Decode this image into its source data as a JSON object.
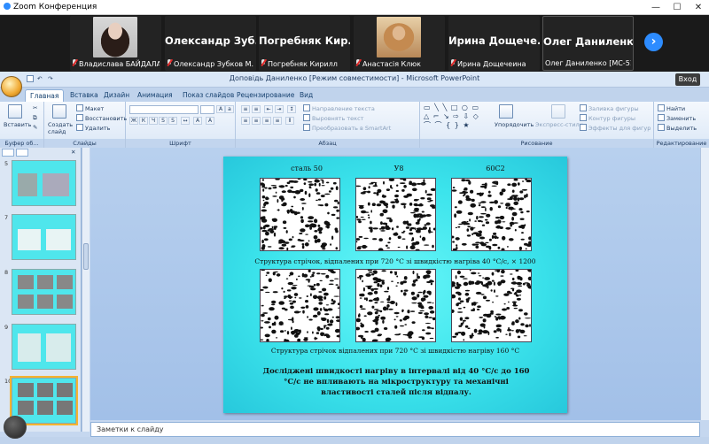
{
  "zoom": {
    "window_title": "Zoom Конференция",
    "next_label": "›"
  },
  "participants": [
    {
      "name_big": "",
      "label": "Владислава БАЙДАЛА...",
      "has_photo": true
    },
    {
      "name_big": "Олександр Зуб...",
      "label": "Олександр Зубков М..."
    },
    {
      "name_big": "Погребняк Кир...",
      "label": "Погребняк Кирилл"
    },
    {
      "name_big": "",
      "label": "Анастасія Клюк",
      "has_photo": true
    },
    {
      "name_big": "Ирина Дощече...",
      "label": "Ирина Дощечеина"
    },
    {
      "name_big": "Олег Даниленко",
      "label": "Олег Даниленко [МС-51-...",
      "active": true
    }
  ],
  "ppt": {
    "title": "Доповідь Даниленко [Режим совместимости] - Microsoft PowerPoint",
    "signin": "Вход",
    "tabs": [
      "Главная",
      "Вставка",
      "Дизайн",
      "Анимация",
      "Показ слайдов",
      "Рецензирование",
      "Вид"
    ],
    "ribbon": {
      "clipboard": {
        "paste": "Вставить",
        "label": "Буфер об..."
      },
      "slides": {
        "create": "Создать слайд",
        "layout": "Макет",
        "reset": "Восстановить",
        "delete": "Удалить",
        "label": "Слайды"
      },
      "font": {
        "label": "Шрифт"
      },
      "paragraph": {
        "text_dir": "Направление текста",
        "align_text": "Выровнять текст",
        "smartart": "Преобразовать в SmartArt",
        "label": "Абзац"
      },
      "drawing": {
        "arrange": "Упорядочить",
        "quick_styles": "Экспресс-стили",
        "fill": "Заливка фигуры",
        "outline": "Контур фигуры",
        "effects": "Эффекты для фигур",
        "label": "Рисование"
      },
      "editing": {
        "find": "Найти",
        "replace": "Заменить",
        "select": "Выделить",
        "label": "Редактирование"
      }
    },
    "thumbs": [
      {
        "num": "5"
      },
      {
        "num": "7"
      },
      {
        "num": "8"
      },
      {
        "num": "9"
      },
      {
        "num": "10"
      }
    ],
    "notes_placeholder": "Заметки к слайду"
  },
  "slide": {
    "col_labels": [
      "сталь 50",
      "У8",
      "60С2"
    ],
    "caption1": "Структура стрічок, відпалених  при 720 °С зі  швидкістю нагріва 40 °С/с, × 1200",
    "caption2": "Структура стрічок відпалених при 720 °С зі швидкістю нагріву 160 °С",
    "conclusion": "Досліджені  швидкості нагріву в інтервалі від 40 °С/с до 160 °С/с не впливають на  мікроструктуру та механічні властивості сталей після відпалу."
  },
  "colors": {
    "slide_bg": "#3ce4ec",
    "zoom_blue": "#2d8cff",
    "ribbon_bg": "#dce8f7"
  }
}
